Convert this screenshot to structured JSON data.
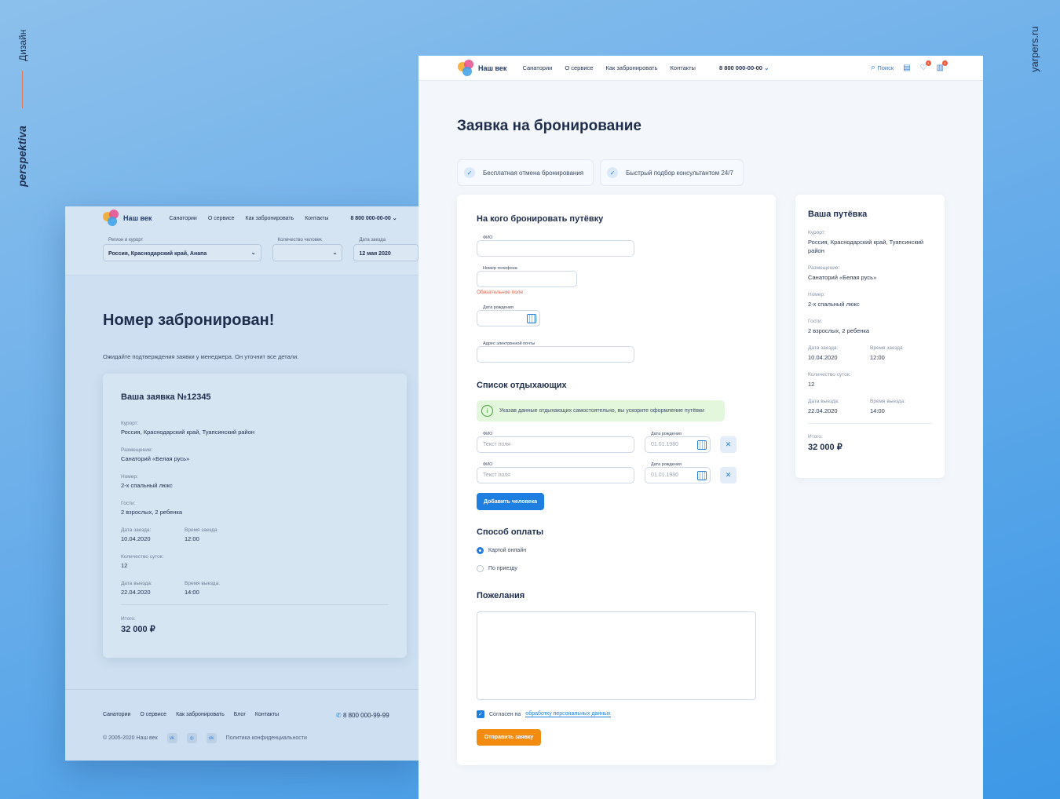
{
  "side": {
    "design": "Дизайн",
    "brand": "perspektiva",
    "site": "yarpers.ru"
  },
  "left": {
    "nav": {
      "links": [
        "Санатории",
        "О сервисе",
        "Как забронировать",
        "Контакты"
      ],
      "phone": "8 800 000-00-00"
    },
    "filters": {
      "region_label": "Регион и курорт",
      "region_value": "Россия, Краснодарский край, Анапа",
      "people_label": "Количество человек",
      "people_value": "",
      "date_label": "Дата заезда",
      "date_value": "12 мая 2020"
    },
    "title": "Номер забронирован!",
    "subtitle": "Ожидайте подтверждения заявки у менеджера. Он уточнит все детали.",
    "card": {
      "title": "Ваша заявка №12345",
      "resort_k": "Курорт:",
      "resort_v": "Россия, Краснодарский край, Туапсинский район",
      "place_k": "Размещение:",
      "place_v": "Санаторий «Белая русь»",
      "room_k": "Номер:",
      "room_v": "2-х спальный люкс",
      "guests_k": "Гости:",
      "guests_v": "2 взрослых, 2 ребенка",
      "in_k": "Дата заезда:",
      "in_v": "10.04.2020",
      "intime_k": "Время заезда",
      "intime_v": "12:00",
      "days_k": "Количество суток:",
      "days_v": "12",
      "out_k": "Дата выезда:",
      "out_v": "22.04.2020",
      "outtime_k": "Время выезда:",
      "outtime_v": "14:00",
      "total_k": "Итого:",
      "total_v": "32 000 ₽"
    },
    "footer": {
      "links": [
        "Санатории",
        "О сервисе",
        "Как забронировать",
        "Блог",
        "Контакты"
      ],
      "phone": "8 800 000-99-99",
      "copyright": "© 2005-2020 Наш век",
      "policy": "Политика конфиденциальности"
    }
  },
  "right": {
    "logo": "Наш век",
    "nav": {
      "links": [
        "Санатории",
        "О сервисе",
        "Как забронировать",
        "Контакты"
      ],
      "phone": "8 800 000-00-00",
      "search": "Поиск",
      "fav_count": "3",
      "cmp_count": "2"
    },
    "title": "Заявка на бронирование",
    "chips": [
      "Бесплатная отмена бронирования",
      "Быстрый подбор консультантом 24/7"
    ],
    "form": {
      "h_who": "На кого бронировать путёвку",
      "fio_label": "ФИО",
      "phone_label": "Номер телефона",
      "required": "Обязательное поле",
      "birth_label": "Дата рождения",
      "email_label": "Адрес электронной почты",
      "h_list": "Список отдыхающих",
      "info": "Указав данные отдыхающих самостоятельно, вы ускорите оформление путёвки",
      "g_fio_label": "ФИО",
      "g_fio_ph": "Текст поля",
      "g_birth_label": "Дата рождения",
      "g_birth_ph": "01.01.1980",
      "add_btn": "Добавить человека",
      "h_pay": "Способ оплаты",
      "pay1": "Картой онлайн",
      "pay2": "По приезду",
      "h_wish": "Пожелания",
      "agree": "Согласен на",
      "agree_link": "обработку персональных данных",
      "submit": "Отправить заявку"
    },
    "summary": {
      "title": "Ваша путёвка",
      "resort_k": "Курорт:",
      "resort_v": "Россия, Краснодарский край, Туапсинский район",
      "place_k": "Размещение:",
      "place_v": "Санаторий «Белая русь»",
      "room_k": "Номер:",
      "room_v": "2-х спальный люкс",
      "guests_k": "Гости:",
      "guests_v": "2 взрослых, 2 ребенка",
      "in_k": "Дата заезда:",
      "in_v": "10.04.2020",
      "intime_k": "Время заезда",
      "intime_v": "12:00",
      "days_k": "Количество суток:",
      "days_v": "12",
      "out_k": "Дата выезда:",
      "out_v": "22.04.2020",
      "outtime_k": "Время выезда:",
      "outtime_v": "14:00",
      "total_k": "Итого:",
      "total_v": "32 000 ₽"
    }
  }
}
